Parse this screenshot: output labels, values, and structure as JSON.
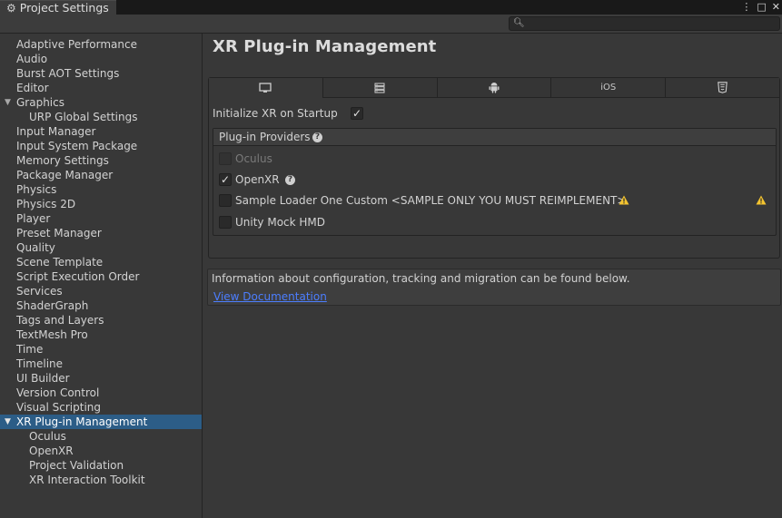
{
  "window": {
    "tab_title": "Project Settings",
    "controls": [
      "⋮",
      "□",
      "✕"
    ]
  },
  "search": {
    "value": "",
    "placeholder": ""
  },
  "sidebar": {
    "items": [
      {
        "label": "Adaptive Performance",
        "level": 0
      },
      {
        "label": "Audio",
        "level": 0
      },
      {
        "label": "Burst AOT Settings",
        "level": 0
      },
      {
        "label": "Editor",
        "level": 0
      },
      {
        "label": "Graphics",
        "level": 0,
        "expanded": true
      },
      {
        "label": "URP Global Settings",
        "level": 1
      },
      {
        "label": "Input Manager",
        "level": 0
      },
      {
        "label": "Input System Package",
        "level": 0
      },
      {
        "label": "Memory Settings",
        "level": 0
      },
      {
        "label": "Package Manager",
        "level": 0
      },
      {
        "label": "Physics",
        "level": 0
      },
      {
        "label": "Physics 2D",
        "level": 0
      },
      {
        "label": "Player",
        "level": 0
      },
      {
        "label": "Preset Manager",
        "level": 0
      },
      {
        "label": "Quality",
        "level": 0
      },
      {
        "label": "Scene Template",
        "level": 0
      },
      {
        "label": "Script Execution Order",
        "level": 0
      },
      {
        "label": "Services",
        "level": 0
      },
      {
        "label": "ShaderGraph",
        "level": 0
      },
      {
        "label": "Tags and Layers",
        "level": 0
      },
      {
        "label": "TextMesh Pro",
        "level": 0
      },
      {
        "label": "Time",
        "level": 0
      },
      {
        "label": "Timeline",
        "level": 0
      },
      {
        "label": "UI Builder",
        "level": 0
      },
      {
        "label": "Version Control",
        "level": 0
      },
      {
        "label": "Visual Scripting",
        "level": 0
      },
      {
        "label": "XR Plug-in Management",
        "level": 0,
        "expanded": true,
        "selected": true
      },
      {
        "label": "Oculus",
        "level": 1
      },
      {
        "label": "OpenXR",
        "level": 1
      },
      {
        "label": "Project Validation",
        "level": 1
      },
      {
        "label": "XR Interaction Toolkit",
        "level": 1
      }
    ]
  },
  "main": {
    "title": "XR Plug-in Management",
    "platform_tabs": [
      {
        "icon": "desktop-icon",
        "label": "",
        "active": true
      },
      {
        "icon": "server-icon",
        "label": ""
      },
      {
        "icon": "android-icon",
        "label": ""
      },
      {
        "icon": "ios-icon",
        "label": "iOS"
      },
      {
        "icon": "html5-icon",
        "label": ""
      }
    ],
    "init_on_startup": {
      "label": "Initialize XR on Startup",
      "checked": true
    },
    "providers": {
      "header": "Plug-in Providers",
      "items": [
        {
          "label": "Oculus",
          "checked": false,
          "disabled": true
        },
        {
          "label": "OpenXR",
          "checked": true,
          "help": true
        },
        {
          "label": "Sample Loader One Custom <SAMPLE ONLY YOU MUST REIMPLEMENT>",
          "checked": false,
          "warning": true
        },
        {
          "label": "Unity Mock HMD",
          "checked": false
        }
      ]
    },
    "info": {
      "text": "Information about configuration, tracking and migration can be found below.",
      "link": "View Documentation"
    }
  },
  "colors": {
    "background": "#383838",
    "selection": "#2c5d87",
    "link": "#4c7eff",
    "warning": "#f4c430"
  }
}
